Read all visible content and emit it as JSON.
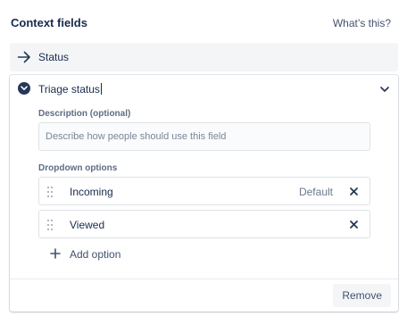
{
  "header": {
    "title": "Context fields",
    "help_link": "What’s this?"
  },
  "status_field": {
    "label": "Status",
    "icon": "arrow-right-icon"
  },
  "context_field": {
    "name": "Triage status",
    "expanded": true,
    "description_label": "Description (optional)",
    "description_placeholder": "Describe how people should use this field",
    "description_value": "",
    "options_label": "Dropdown options",
    "options": [
      {
        "label": "Incoming",
        "default_label": "Default"
      },
      {
        "label": "Viewed"
      }
    ],
    "add_option_label": "Add option",
    "remove_label": "Remove"
  },
  "colors": {
    "text": "#172b4d",
    "subtle_text": "#5e6c84",
    "row_background": "#f4f5f7",
    "border": "#dfe1e6"
  }
}
